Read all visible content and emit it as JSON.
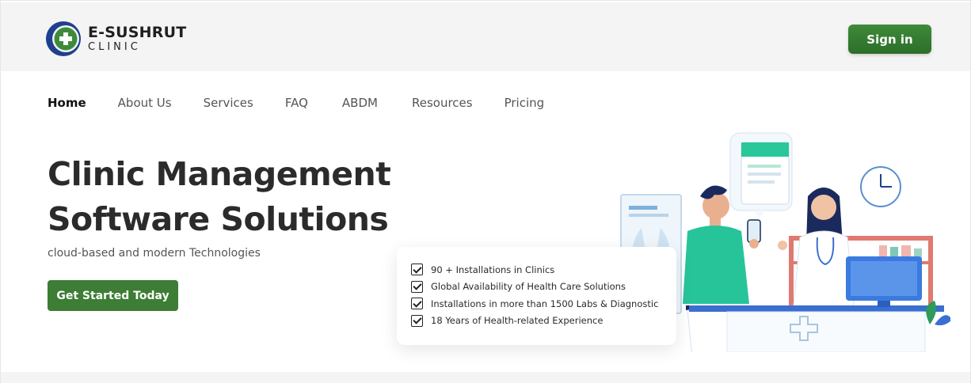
{
  "brand": {
    "title": "E-SUSHRUT",
    "subtitle": "CLINIC",
    "colors": {
      "blue": "#1f3f8f",
      "green": "#3d8b3a"
    }
  },
  "header": {
    "signin_label": "Sign in"
  },
  "nav": {
    "items": [
      {
        "label": "Home",
        "active": true
      },
      {
        "label": "About Us"
      },
      {
        "label": "Services"
      },
      {
        "label": "FAQ"
      },
      {
        "label": "ABDM"
      },
      {
        "label": "Resources"
      },
      {
        "label": "Pricing"
      }
    ]
  },
  "hero": {
    "title_line1": "Clinic Management",
    "title_line2": "Software Solutions",
    "subtitle": "cloud-based and modern Technologies",
    "cta_label": "Get Started Today"
  },
  "features": [
    "90 + Installations in Clinics",
    "Global Availability of Health Care Solutions",
    "Installations in more than 1500 Labs & Diagnostic",
    "18 Years of Health-related Experience"
  ],
  "theme": {
    "accent_green": "#3d7d36",
    "topbar_bg": "#f4f4f4"
  }
}
